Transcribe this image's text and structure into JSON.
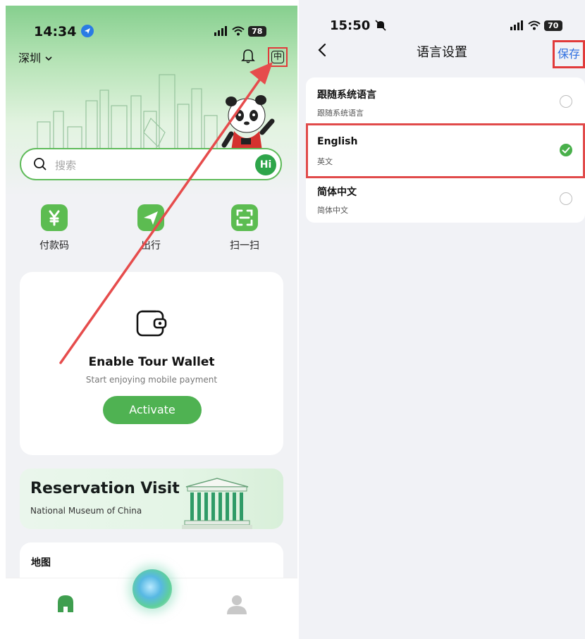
{
  "left_screen": {
    "status": {
      "time": "14:34",
      "battery": "78"
    },
    "header": {
      "city": "深圳",
      "lang_button": "中"
    },
    "search": {
      "placeholder": "搜索",
      "hi_badge": "Hi"
    },
    "quick_actions": [
      {
        "label": "付款码"
      },
      {
        "label": "出行"
      },
      {
        "label": "扫一扫"
      }
    ],
    "wallet_card": {
      "title": "Enable Tour Wallet",
      "subtitle": "Start enjoying mobile payment",
      "button": "Activate"
    },
    "reservation_card": {
      "title": "Reservation Visit",
      "subtitle": "National Museum of China"
    },
    "map_card": {
      "title": "地图"
    }
  },
  "right_screen": {
    "status": {
      "time": "15:50",
      "battery": "70"
    },
    "nav": {
      "title": "语言设置",
      "save": "保存"
    },
    "options": [
      {
        "name": "跟随系统语言",
        "desc": "跟随系统语言",
        "selected": false
      },
      {
        "name": "English",
        "desc": "英文",
        "selected": true
      },
      {
        "name": "简体中文",
        "desc": "简体中文",
        "selected": false
      }
    ]
  },
  "colors": {
    "accent_green": "#4fb252",
    "annotation_red": "#e13a3a",
    "link_blue": "#2f6fe0"
  }
}
